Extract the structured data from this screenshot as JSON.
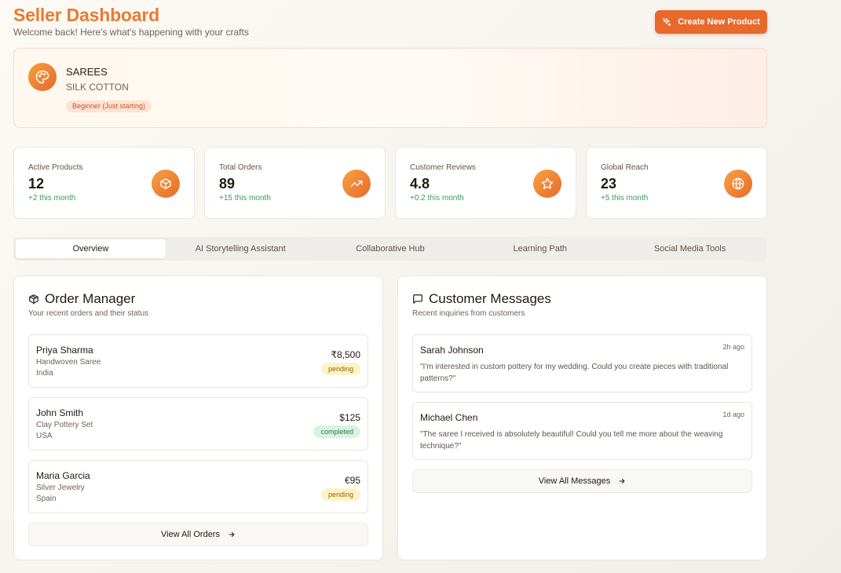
{
  "header": {
    "title": "Seller Dashboard",
    "subtitle": "Welcome back! Here's what's happening with your crafts",
    "create_label": "Create New Product"
  },
  "profile": {
    "name": "SAREES",
    "category": "SILK COTTON",
    "level": "Beginner (Just starting)"
  },
  "stats": [
    {
      "label": "Active Products",
      "value": "12",
      "change": "+2 this month",
      "icon": "box-icon"
    },
    {
      "label": "Total Orders",
      "value": "89",
      "change": "+15 this month",
      "icon": "trending-up-icon"
    },
    {
      "label": "Customer Reviews",
      "value": "4.8",
      "change": "+0.2 this month",
      "icon": "star-icon"
    },
    {
      "label": "Global Reach",
      "value": "23",
      "change": "+5 this month",
      "icon": "globe-icon"
    }
  ],
  "tabs": [
    {
      "label": "Overview",
      "active": true
    },
    {
      "label": "AI Storytelling Assistant",
      "active": false
    },
    {
      "label": "Collaborative Hub",
      "active": false
    },
    {
      "label": "Learning Path",
      "active": false
    },
    {
      "label": "Social Media Tools",
      "active": false
    }
  ],
  "orders": {
    "title": "Order Manager",
    "subtitle": "Your recent orders and their status",
    "items": [
      {
        "name": "Priya Sharma",
        "product": "Handwoven Saree",
        "country": "India",
        "price": "₹8,500",
        "status": "pending"
      },
      {
        "name": "John Smith",
        "product": "Clay Pottery Set",
        "country": "USA",
        "price": "$125",
        "status": "completed"
      },
      {
        "name": "Maria Garcia",
        "product": "Silver Jewelry",
        "country": "Spain",
        "price": "€95",
        "status": "pending"
      }
    ],
    "view_all": "View All Orders"
  },
  "messages": {
    "title": "Customer Messages",
    "subtitle": "Recent inquiries from customers",
    "items": [
      {
        "name": "Sarah Johnson",
        "time": "2h ago",
        "text": "\"I'm interested in custom pottery for my wedding. Could you create pieces with traditional patterns?\""
      },
      {
        "name": "Michael Chen",
        "time": "1d ago",
        "text": "\"The saree I received is absolutely beautiful! Could you tell me more about the weaving technique?\""
      }
    ],
    "view_all": "View All Messages"
  },
  "colors": {
    "accent": "#e8692c",
    "title_orange": "#ea7a2f",
    "positive": "#3a9a5b"
  }
}
